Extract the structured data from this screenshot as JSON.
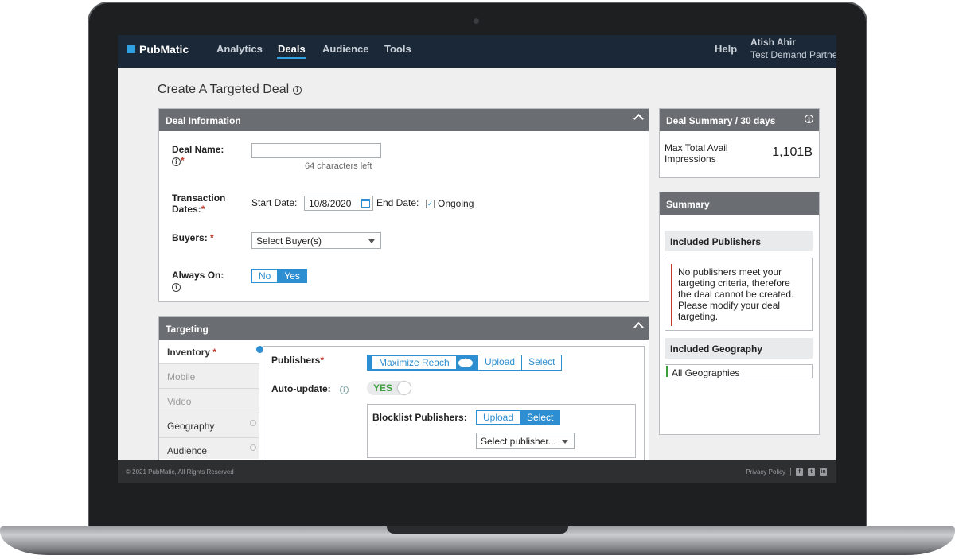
{
  "nav": {
    "logo": "PubMatic",
    "items": [
      {
        "label": "Analytics"
      },
      {
        "label": "Deals"
      },
      {
        "label": "Audience"
      },
      {
        "label": "Tools"
      }
    ],
    "help": "Help",
    "user_name": "Atish Ahir",
    "user_org": "Test Demand Partner"
  },
  "page": {
    "title": "Create A Targeted Deal"
  },
  "deal_info": {
    "header": "Deal Information",
    "deal_name_label": "Deal Name:",
    "deal_name_value": "",
    "chars_left": "64 characters left",
    "transaction_label": "Transaction",
    "transaction_label2": "Dates:",
    "start_date_label": "Start Date:",
    "start_date_value": "10/8/2020",
    "end_date_label": "End Date:",
    "ongoing_label": "Ongoing",
    "ongoing_checked": "✓",
    "buyers_label": "Buyers:",
    "buyers_placeholder": "Select Buyer(s)",
    "always_on_label": "Always On:",
    "always_on_no": "No",
    "always_on_yes": "Yes"
  },
  "targeting": {
    "header": "Targeting",
    "tabs": [
      {
        "label": "Inventory"
      },
      {
        "label": "Mobile"
      },
      {
        "label": "Video"
      },
      {
        "label": "Geography"
      },
      {
        "label": "Audience"
      }
    ],
    "publishers_label": "Publishers",
    "maximize_reach": "Maximize Reach",
    "upload": "Upload",
    "select": "Select",
    "auto_update_label": "Auto-update:",
    "auto_update_value": "YES",
    "blocklist_label": "Blocklist Publishers:",
    "blocklist_upload": "Upload",
    "blocklist_select": "Select",
    "select_publisher_placeholder": "Select publisher..."
  },
  "deal_summary": {
    "header": "Deal Summary / 30 days",
    "metric_label": "Max Total Avail Impressions",
    "metric_value": "1,101B"
  },
  "summary": {
    "header": "Summary",
    "included_publishers": "Included Publishers",
    "message": "No publishers meet your targeting criteria, therefore the deal cannot be created. Please modify your deal targeting.",
    "included_geography": "Included Geography",
    "geography_value": "All Geographies"
  },
  "footer": {
    "copyright": "© 2021 PubMatic, All Rights Reserved",
    "privacy": "Privacy Policy"
  },
  "colors": {
    "nav_bg": "#1b2838",
    "accent": "#2d8fd1",
    "panel_header": "#6a6e73",
    "error": "#c0392b",
    "success": "#3aa13a"
  }
}
